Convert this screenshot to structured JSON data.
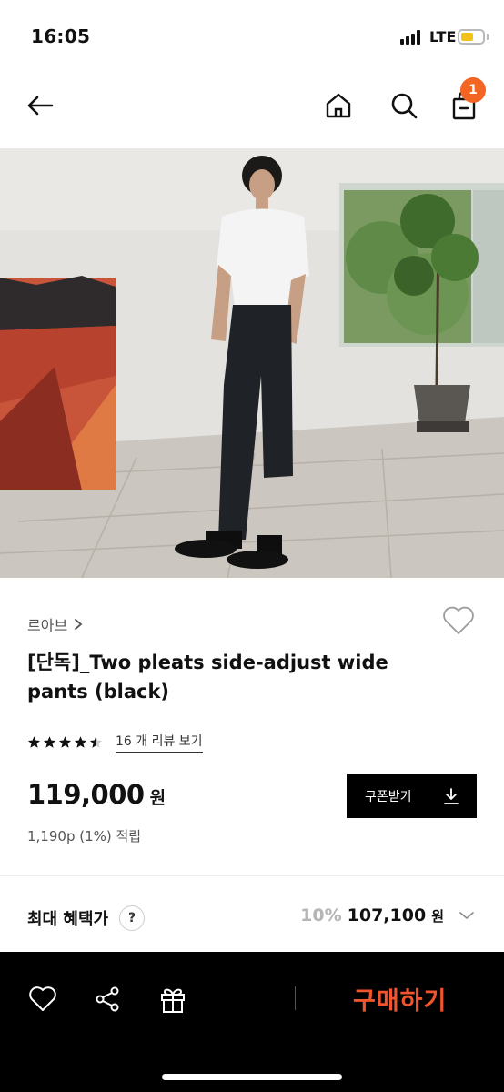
{
  "status_bar": {
    "time": "16:05",
    "network": "LTE",
    "battery_level": 0.6
  },
  "header": {
    "cart_count": "1"
  },
  "product": {
    "brand": "르아브",
    "title": "[단독]_Two pleats side-adjust wide pants (black)",
    "rating": 4.5,
    "review_link": "16 개 리뷰 보기",
    "price": "119,000",
    "price_unit": "원",
    "coupon_label": "쿠폰받기",
    "points": "1,190p (1%) 적립"
  },
  "benefit": {
    "label": "최대 혜택가",
    "help": "?",
    "rate": "10%",
    "price": "107,100",
    "unit": "원"
  },
  "bottom_bar": {
    "buy_label": "구매하기"
  },
  "colors": {
    "accent": "#f26522",
    "buy": "#f2542d"
  }
}
